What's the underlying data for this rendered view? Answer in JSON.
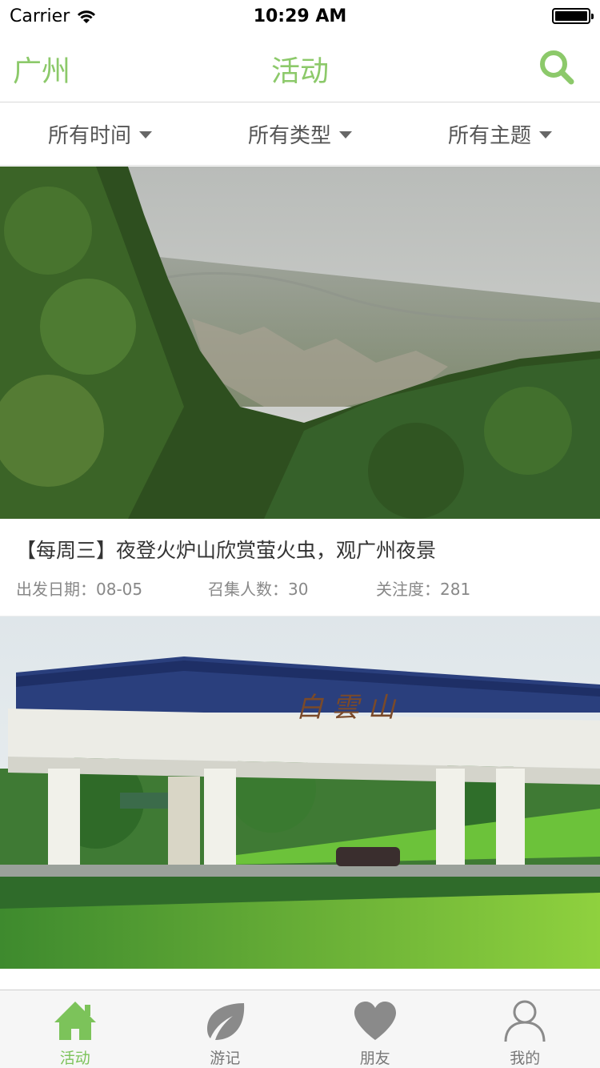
{
  "status_bar": {
    "carrier": "Carrier",
    "time": "10:29 AM"
  },
  "nav": {
    "city": "广州",
    "title": "活动",
    "search_icon": "search-icon"
  },
  "filters": [
    {
      "label": "所有时间"
    },
    {
      "label": "所有类型"
    },
    {
      "label": "所有主题"
    }
  ],
  "cards": [
    {
      "title": "【每周三】夜登火炉山欣赏萤火虫，观广州夜景",
      "date": "出发日期：08-05",
      "count": "召集人数：30",
      "attention": "关注度：281"
    }
  ],
  "tabs": [
    {
      "label": "活动",
      "icon": "home-icon",
      "active": true
    },
    {
      "label": "游记",
      "icon": "leaf-icon",
      "active": false
    },
    {
      "label": "朋友",
      "icon": "heart-icon",
      "active": false
    },
    {
      "label": "我的",
      "icon": "user-icon",
      "active": false
    }
  ],
  "colors": {
    "accent": "#8cc96a",
    "tab_active": "#7cc35a",
    "tab_inactive": "#8a8a8a"
  }
}
